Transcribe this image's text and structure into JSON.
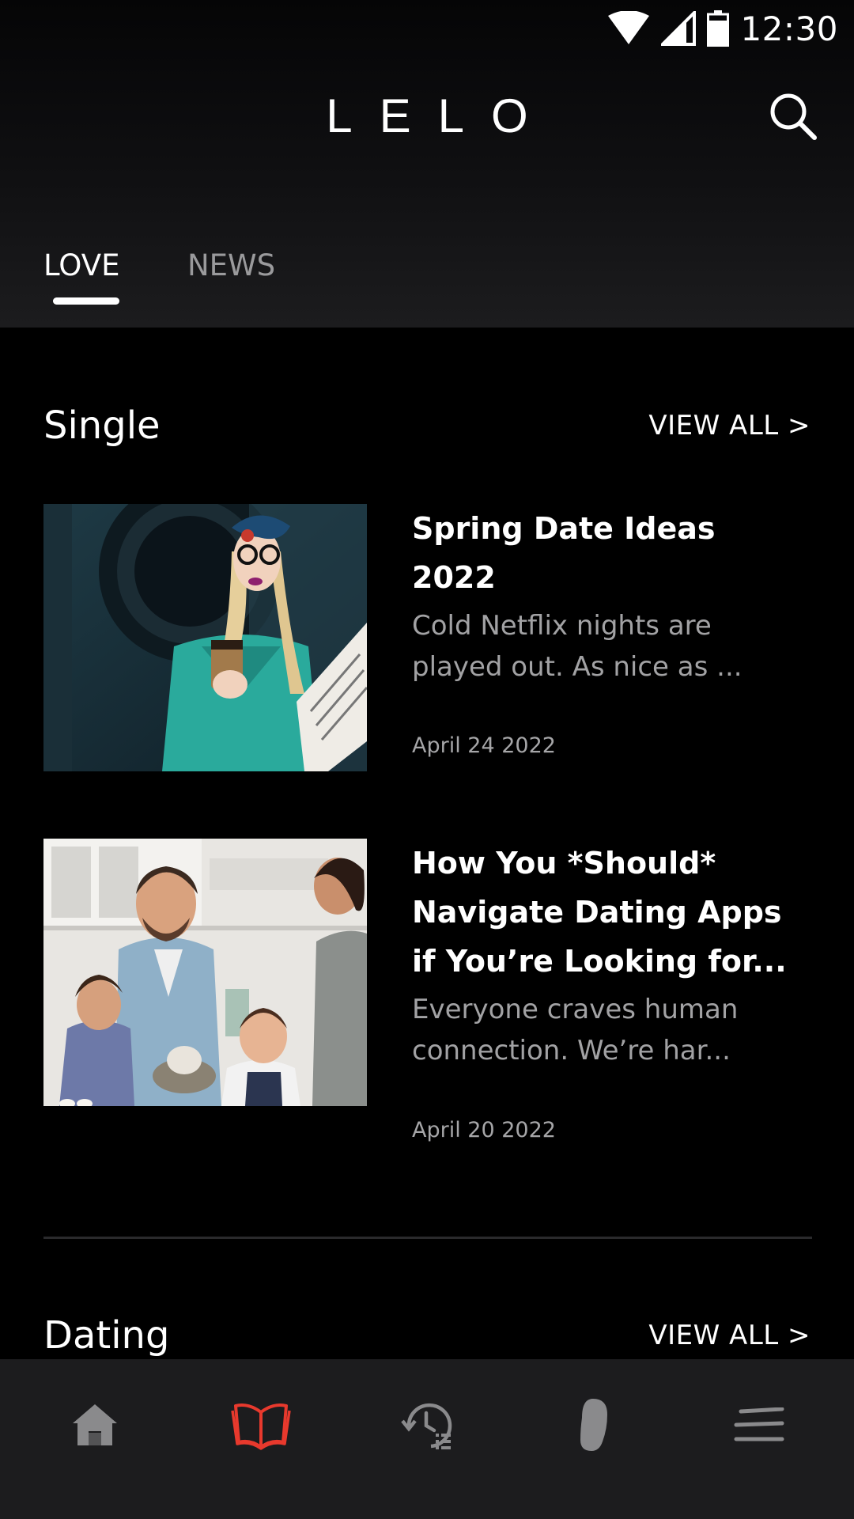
{
  "status_bar": {
    "time": "12:30"
  },
  "header": {
    "logo": "LELO"
  },
  "tabs": [
    {
      "label": "LOVE",
      "active": true
    },
    {
      "label": "NEWS",
      "active": false
    }
  ],
  "sections": [
    {
      "title": "Single",
      "view_all": "VIEW ALL >",
      "articles": [
        {
          "title": "Spring Date Ideas 2022",
          "excerpt": "Cold Netflix nights are played out. As nice as ...",
          "date": "April 24 2022"
        },
        {
          "title": "How You *Should* Navigate Dating Apps if You’re Looking for...",
          "excerpt": "Everyone craves human connection. We’re har...",
          "date": "April 20 2022"
        }
      ]
    },
    {
      "title": "Dating",
      "view_all": "VIEW ALL >"
    }
  ],
  "bottom_nav": [
    {
      "icon": "home-icon",
      "active": false
    },
    {
      "icon": "open-book-icon",
      "active": true
    },
    {
      "icon": "history-icon",
      "active": false
    },
    {
      "icon": "device-icon",
      "active": false
    },
    {
      "icon": "menu-icon",
      "active": false
    }
  ],
  "colors": {
    "accent": "#e8392d",
    "inactive_icon": "#8a8a8c",
    "nav_bg": "#1c1c1e"
  }
}
